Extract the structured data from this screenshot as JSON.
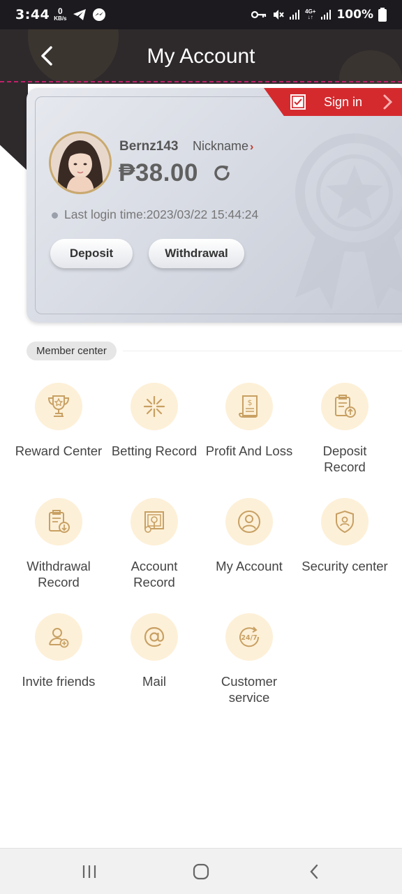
{
  "status_bar": {
    "time": "3:44",
    "net_speed_value": "0",
    "net_speed_unit": "KB/s",
    "network_label": "4G+",
    "battery": "100%"
  },
  "header": {
    "title": "My Account"
  },
  "account_card": {
    "sign_in_label": "Sign in",
    "username": "Bernz143",
    "nickname_label": "Nickname",
    "balance": "₱38.00",
    "last_login": "Last login time:2023/03/22 15:44:24",
    "deposit_label": "Deposit",
    "withdrawal_label": "Withdrawal"
  },
  "member_center": {
    "section_label": "Member center",
    "items": [
      {
        "label": "Reward Center",
        "icon": "trophy-icon"
      },
      {
        "label": "Betting Record",
        "icon": "stars-icon"
      },
      {
        "label": "Profit And Loss",
        "icon": "bill-icon"
      },
      {
        "label": "Deposit Record",
        "icon": "clipboard-up-icon"
      },
      {
        "label": "Withdrawal Record",
        "icon": "clipboard-down-icon"
      },
      {
        "label": "Account Record",
        "icon": "account-record-icon"
      },
      {
        "label": "My Account",
        "icon": "user-icon"
      },
      {
        "label": "Security center",
        "icon": "shield-user-icon"
      },
      {
        "label": "Invite friends",
        "icon": "user-add-icon"
      },
      {
        "label": "Mail",
        "icon": "at-icon"
      },
      {
        "label": "Customer service",
        "icon": "24-7-icon"
      }
    ]
  },
  "colors": {
    "header_bg": "#2e2a2c",
    "sign_in_red": "#d42a2e",
    "icon_circle": "#fdf0d8",
    "icon_gold": "#c8a063"
  }
}
